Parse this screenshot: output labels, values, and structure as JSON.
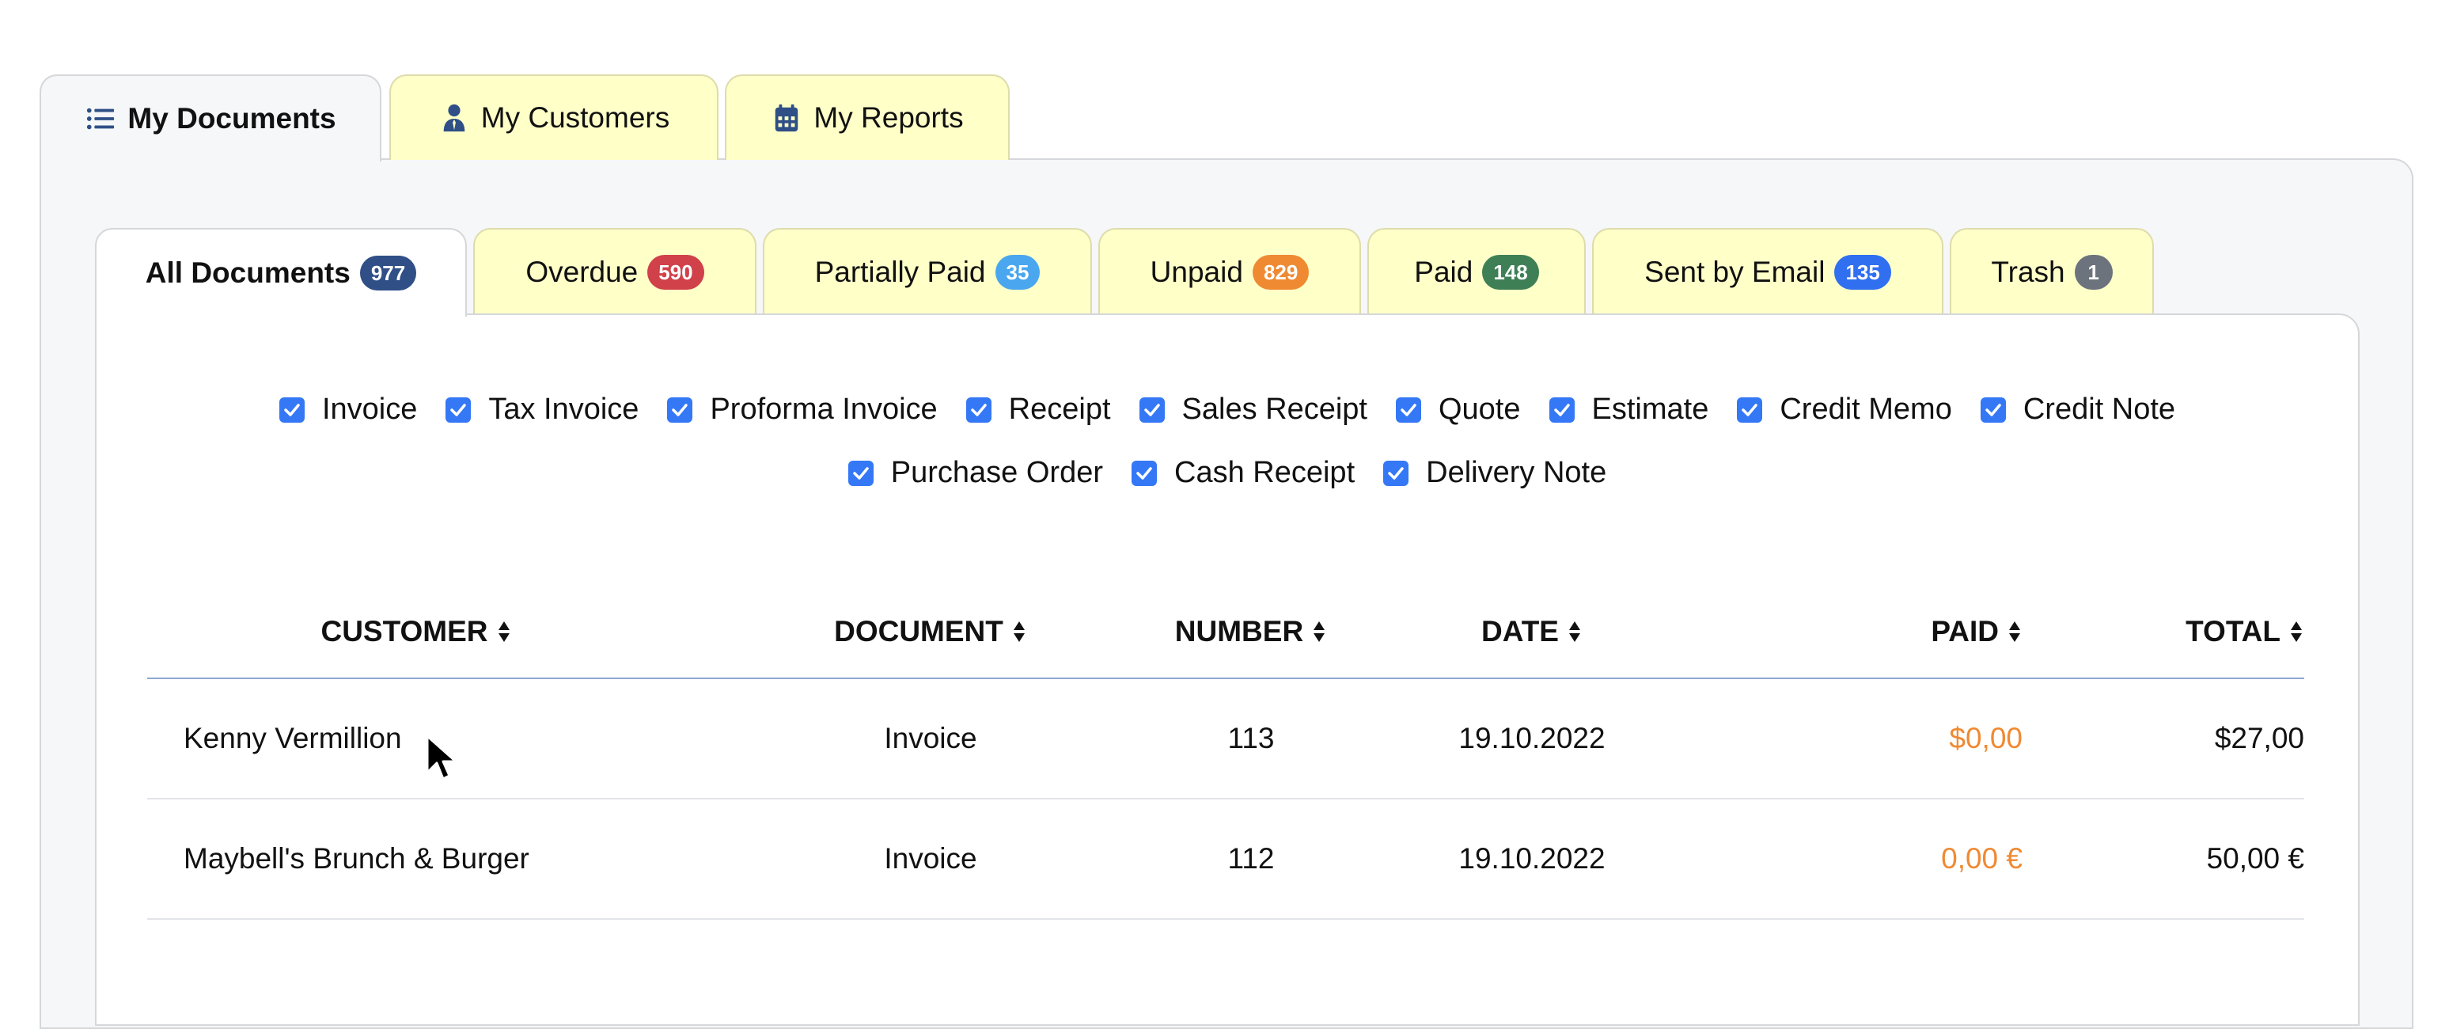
{
  "outer_tabs": [
    {
      "label": "My Documents",
      "icon": "list-icon",
      "active": true
    },
    {
      "label": "My Customers",
      "icon": "user-tie-icon",
      "active": false
    },
    {
      "label": "My Reports",
      "icon": "calendar-icon",
      "active": false
    }
  ],
  "inner_tabs": [
    {
      "label": "All Documents",
      "count": "977",
      "color": "#2f4f86",
      "active": true
    },
    {
      "label": "Overdue",
      "count": "590",
      "color": "#d0414a",
      "active": false
    },
    {
      "label": "Partially Paid",
      "count": "35",
      "color": "#4aa6ee",
      "active": false
    },
    {
      "label": "Unpaid",
      "count": "829",
      "color": "#ef8a33",
      "active": false
    },
    {
      "label": "Paid",
      "count": "148",
      "color": "#3e7f55",
      "active": false
    },
    {
      "label": "Sent by Email",
      "count": "135",
      "color": "#2f6ff0",
      "active": false
    },
    {
      "label": "Trash",
      "count": "1",
      "color": "#6c737c",
      "active": false
    }
  ],
  "filters": {
    "row1": [
      {
        "label": "Invoice",
        "checked": true
      },
      {
        "label": "Tax Invoice",
        "checked": true
      },
      {
        "label": "Proforma Invoice",
        "checked": true
      },
      {
        "label": "Receipt",
        "checked": true
      },
      {
        "label": "Sales Receipt",
        "checked": true
      },
      {
        "label": "Quote",
        "checked": true
      },
      {
        "label": "Estimate",
        "checked": true
      },
      {
        "label": "Credit Memo",
        "checked": true
      },
      {
        "label": "Credit Note",
        "checked": true
      }
    ],
    "row2": [
      {
        "label": "Purchase Order",
        "checked": true
      },
      {
        "label": "Cash Receipt",
        "checked": true
      },
      {
        "label": "Delivery Note",
        "checked": true
      }
    ]
  },
  "table": {
    "columns": [
      "CUSTOMER",
      "DOCUMENT",
      "NUMBER",
      "DATE",
      "PAID",
      "TOTAL"
    ],
    "rows": [
      {
        "customer": "Kenny Vermillion",
        "document": "Invoice",
        "number": "113",
        "date": "19.10.2022",
        "paid": "$0,00",
        "total": "$27,00"
      },
      {
        "customer": "Maybell's Brunch & Burger",
        "document": "Invoice",
        "number": "112",
        "date": "19.10.2022",
        "paid": "0,00 €",
        "total": "50,00 €"
      }
    ]
  },
  "colors": {
    "accent": "#2f4f86",
    "tab_inactive_bg": "#ffffc8",
    "paid_text": "#ef8a33",
    "checkbox": "#3478f6"
  }
}
